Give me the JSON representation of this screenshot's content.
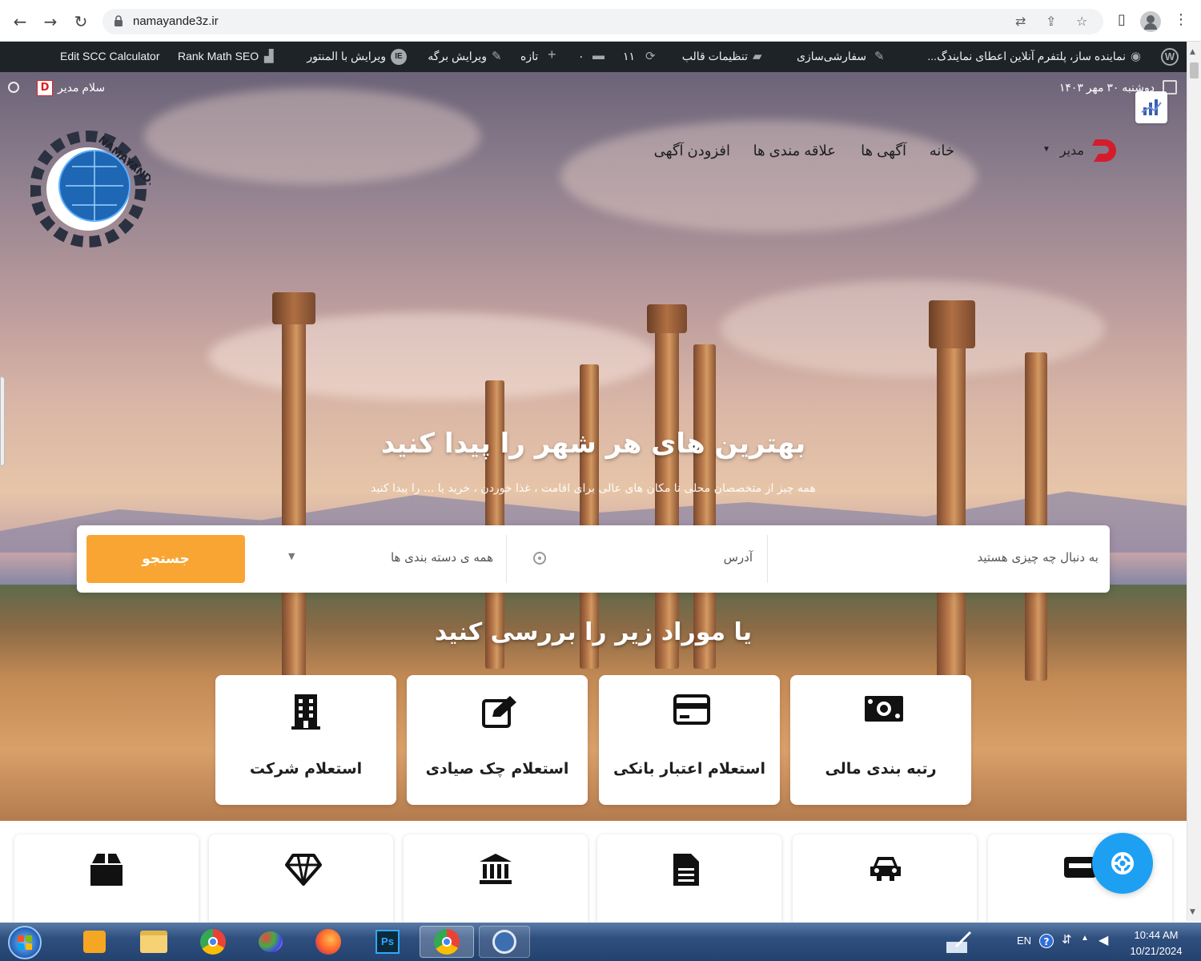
{
  "browser": {
    "url": "namayande3z.ir",
    "back_glyph": "←",
    "forward_glyph": "→",
    "reload_glyph": "↻",
    "translate_glyph": "⇄",
    "share_glyph": "⇪",
    "star_glyph": "☆",
    "sidepanel_glyph": "▯",
    "menu_glyph": "⋮"
  },
  "adminbar": {
    "site": "نماینده ساز، پلتفرم آنلاین اعطای نمایندگ...",
    "customize": "سفارشی‌سازی",
    "theme_settings": "تنظیمات قالب",
    "updates": "۱۱",
    "comments": "۰",
    "new": "تازه",
    "edit_page": "ویرایش برگه",
    "edit_elementor": "ویرایش با المنتور",
    "rank_math": "Rank Math SEO",
    "scc": "Edit SCC Calculator"
  },
  "topline": {
    "date": "دوشنبه ۳۰ مهر ۱۴۰۳",
    "greeting": "سلام مدیر"
  },
  "nav": {
    "home": "خانه",
    "ads": "آگهی ها",
    "favorites": "علاقه مندی ها",
    "add_ad": "افزودن آگهی",
    "user": "مدیر"
  },
  "logo": {
    "text": "NAMAYANDE3Z"
  },
  "hero": {
    "title": "بهترین های هر شهر را پیدا کنید",
    "subtitle": "همه چیز از متخصصان محلی تا مکان های عالی برای اقامت ، غذا خوردن ، خرید یا ... را پیدا کنید"
  },
  "search": {
    "what_placeholder": "به دنبال چه چیزی هستید",
    "address_placeholder": "آدرس",
    "category": "همه ی دسته بندی ها",
    "button": "جستجو"
  },
  "section_title": "یا موراد زیر را بررسی کنید",
  "cards": [
    {
      "label": "رتبه بندی مالی",
      "icon": "money-icon"
    },
    {
      "label": "استعلام اعتبار بانکی",
      "icon": "credit-card-icon"
    },
    {
      "label": "استعلام چک صیادی",
      "icon": "edit-icon"
    },
    {
      "label": "استعلام شرکت",
      "icon": "building-icon"
    }
  ],
  "cards2": [
    {
      "icon": "wallet-icon"
    },
    {
      "icon": "car-icon"
    },
    {
      "icon": "document-icon"
    },
    {
      "icon": "bank-icon"
    },
    {
      "icon": "diamond-icon"
    },
    {
      "icon": "box-icon"
    }
  ],
  "taskbar": {
    "lang": "EN",
    "time": "10:44 AM",
    "date": "10/21/2024",
    "apps": [
      "media-player-icon",
      "file-explorer-icon",
      "chrome-icon",
      "paint-icon",
      "firefox-icon",
      "photoshop-icon",
      "chrome-active-icon",
      "app-icon"
    ]
  },
  "colors": {
    "accent": "#f9a533",
    "fab": "#1ea0f2",
    "adminbar": "#1d2327"
  }
}
